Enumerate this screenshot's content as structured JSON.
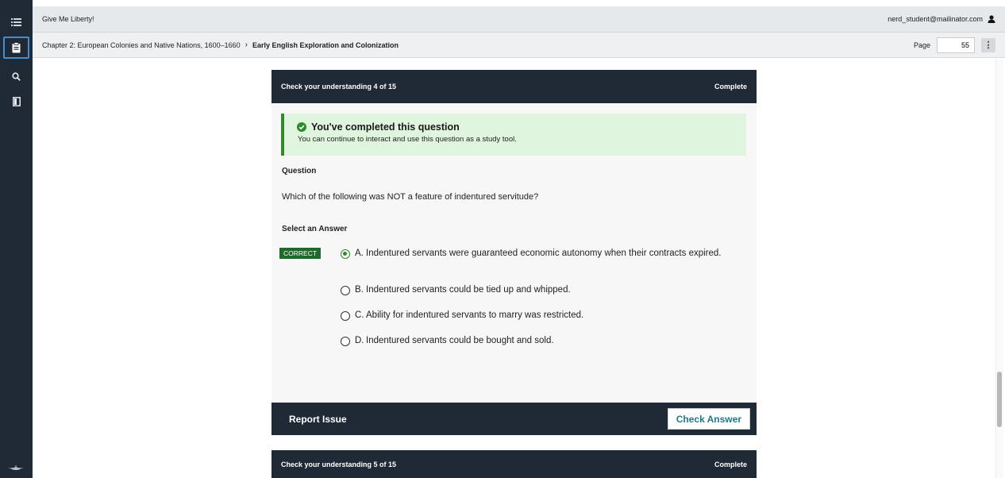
{
  "app": {
    "title": "Give Me Liberty!"
  },
  "user": {
    "email": "nerd_student@mailinator.com"
  },
  "breadcrumb": {
    "chapter": "Chapter 2: European Colonies and Native Nations, 1600–1660",
    "separator": "›",
    "section": "Early English Exploration and Colonization"
  },
  "page": {
    "label": "Page",
    "value": "55",
    "menu_icon": "⋮"
  },
  "rail": {
    "icons": [
      "list-icon",
      "clipboard-icon",
      "search-icon",
      "notebook-icon",
      "logo-icon"
    ]
  },
  "card4": {
    "header_title": "Check your understanding 4 of 15",
    "header_status": "Complete",
    "alert_title": "You've completed this question",
    "alert_text": "You can continue to interact and use this question as a study tool.",
    "question_label": "Question",
    "question_text": "Which of the following was NOT a feature of indentured servitude?",
    "select_label": "Select an Answer",
    "correct_badge": "CORRECT",
    "options": [
      {
        "letter": "A.",
        "text": "Indentured servants were guaranteed economic autonomy when their contracts expired.",
        "selected": true
      },
      {
        "letter": "B.",
        "text": "Indentured servants could be tied up and whipped.",
        "selected": false
      },
      {
        "letter": "C.",
        "text": "Ability for indentured servants to marry was restricted.",
        "selected": false
      },
      {
        "letter": "D.",
        "text": "Indentured servants could be bought and sold.",
        "selected": false
      }
    ],
    "report_label": "Report Issue",
    "check_label": "Check Answer"
  },
  "card5": {
    "header_title": "Check your understanding 5 of 15",
    "header_status": "Complete"
  },
  "colors": {
    "rail": "#1f2a36",
    "header": "#1f2a36",
    "success": "#2f8a2f",
    "alert_bg": "#dff5dd",
    "badge": "#1f6a2a",
    "check_text": "#1e7a86"
  }
}
